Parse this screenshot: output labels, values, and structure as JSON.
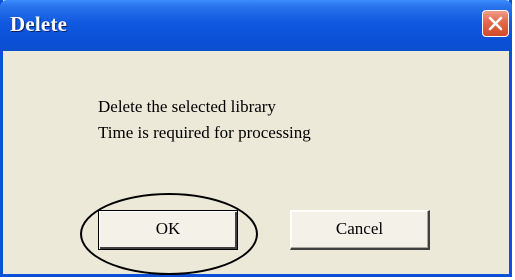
{
  "dialog": {
    "title": "Delete",
    "close_icon": "close-x-icon",
    "message_lines": [
      "Delete the selected library",
      "Time is required for processing"
    ],
    "buttons": {
      "ok_label": "OK",
      "cancel_label": "Cancel"
    }
  },
  "colors": {
    "titlebar": "#0a50d6",
    "close_button": "#d24a2a",
    "body": "#ece9d8"
  }
}
